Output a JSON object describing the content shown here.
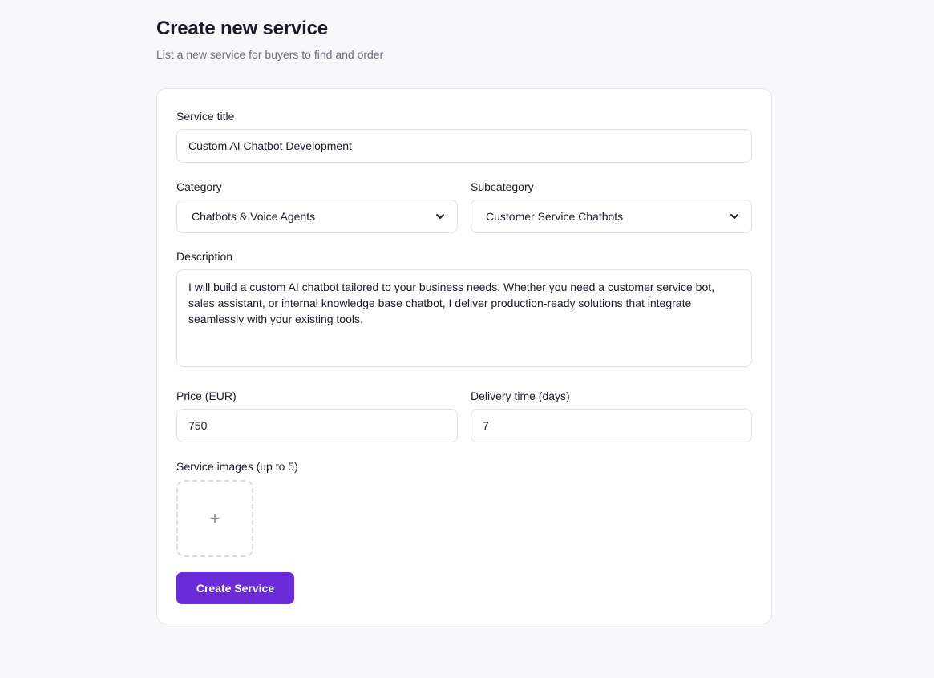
{
  "header": {
    "title": "Create new service",
    "subtitle": "List a new service for buyers to find and order"
  },
  "form": {
    "title_label": "Service title",
    "title_value": "Custom AI Chatbot Development",
    "category_label": "Category",
    "category_value": "Chatbots & Voice Agents",
    "subcategory_label": "Subcategory",
    "subcategory_value": "Customer Service Chatbots",
    "description_label": "Description",
    "description_value": "I will build a custom AI chatbot tailored to your business needs. Whether you need a customer service bot, sales assistant, or internal knowledge base chatbot, I deliver production-ready solutions that integrate seamlessly with your existing tools.",
    "price_label": "Price (EUR)",
    "price_value": "750",
    "delivery_label": "Delivery time (days)",
    "delivery_value": "7",
    "images_label": "Service images (up to 5)",
    "upload_symbol": "+",
    "submit_label": "Create Service"
  },
  "colors": {
    "accent": "#6b2bd8",
    "background": "#f8f8fb",
    "card": "#ffffff"
  },
  "icons": [
    "chevron-down-icon",
    "plus-icon"
  ]
}
